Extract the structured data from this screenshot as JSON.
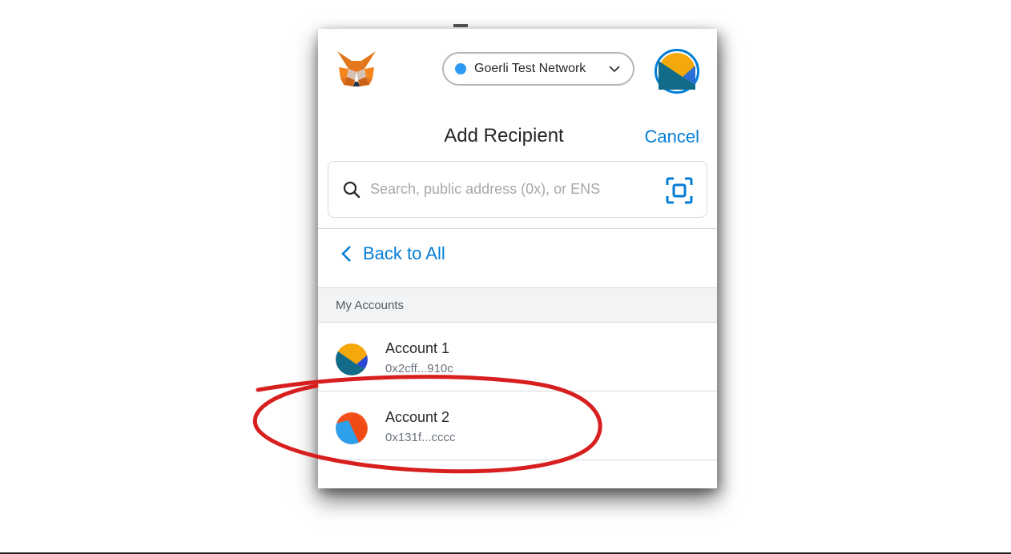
{
  "network": {
    "label": "Goerli Test Network",
    "dot_color": "#3099f2"
  },
  "header": {
    "title": "Add Recipient",
    "cancel_label": "Cancel"
  },
  "search": {
    "placeholder": "Search, public address (0x), or ENS",
    "value": ""
  },
  "nav": {
    "back_label": "Back to All"
  },
  "section": {
    "label": "My Accounts"
  },
  "accounts": [
    {
      "name": "Account 1",
      "address": "0x2cff...910c"
    },
    {
      "name": "Account 2",
      "address": "0x131f...cccc"
    }
  ],
  "icons": {
    "logo": "metamask-fox-icon",
    "network_chevron": "chevron-down-icon",
    "search": "search-icon",
    "scan": "qr-scan-icon",
    "back": "chevron-left-icon"
  },
  "colors": {
    "accent": "#037dd6",
    "annotation": "#d81f1f"
  }
}
